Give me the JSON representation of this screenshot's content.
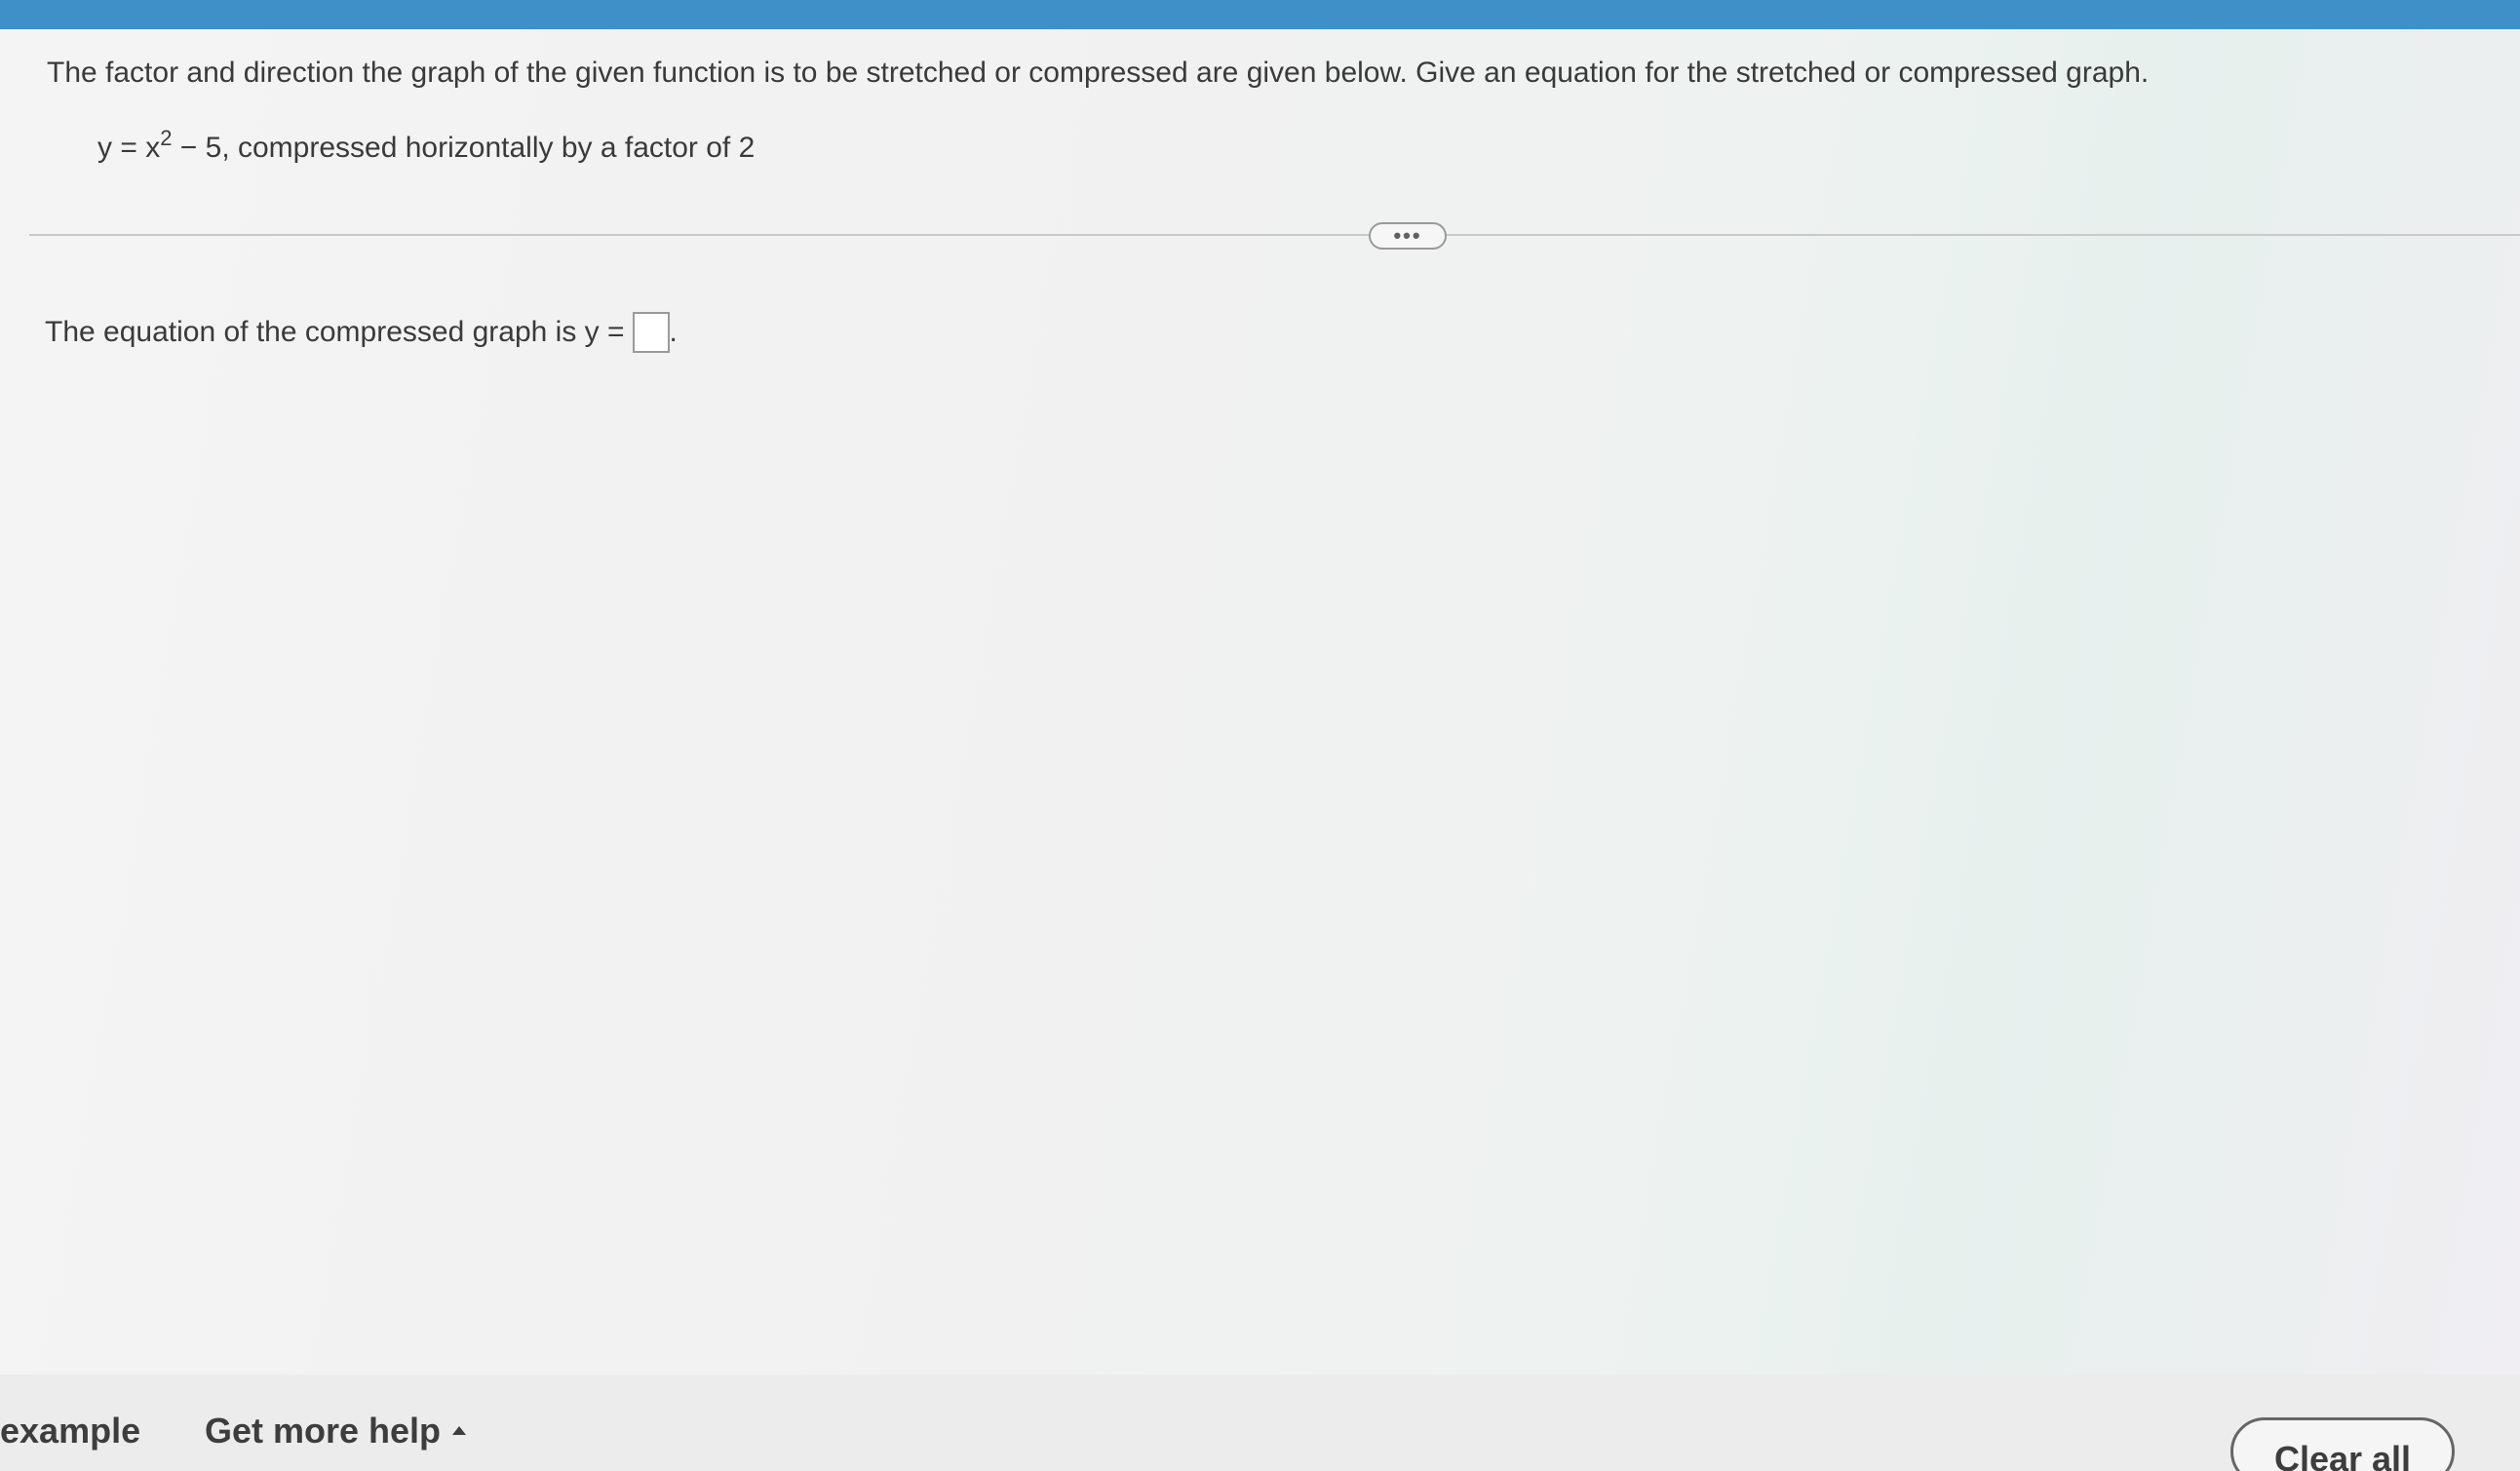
{
  "question": {
    "prompt": "The factor and direction the graph of the given function is to be stretched or compressed are given below. Give an equation for the stretched or compressed graph.",
    "function_prefix": "y = x",
    "function_exponent": "2",
    "function_suffix": " − 5, compressed horizontally by a factor of 2"
  },
  "more_button": {
    "label": "•••"
  },
  "answer": {
    "label": "The equation of the compressed graph is y =",
    "value": "",
    "trailing": "."
  },
  "footer": {
    "example_label": "example",
    "help_label": "Get more help",
    "clear_label": "Clear all"
  },
  "colors": {
    "top_strip": "#3f8fc8",
    "text": "#3a3a3a",
    "divider": "#c9c9c9"
  }
}
